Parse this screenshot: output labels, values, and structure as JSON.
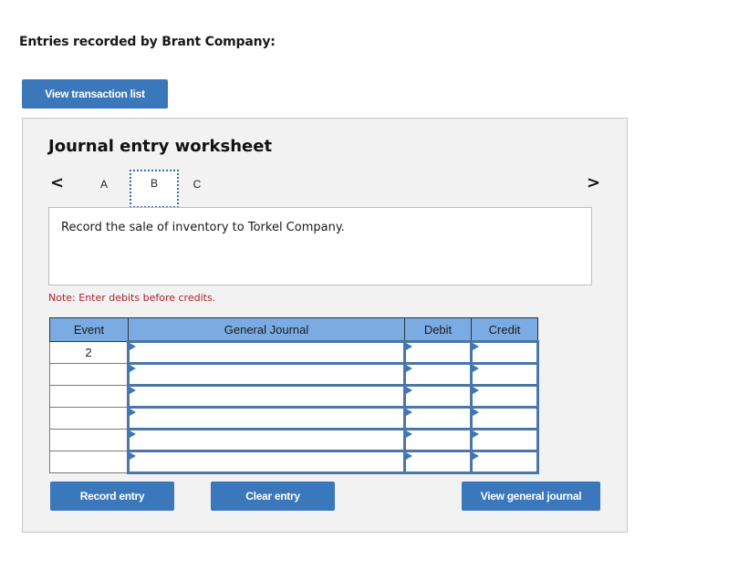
{
  "header": {
    "title": "Entries recorded by Brant Company:",
    "view_transaction_list_label": "View transaction list"
  },
  "worksheet": {
    "title": "Journal entry worksheet",
    "nav": {
      "prev_icon": "chevron-left-icon",
      "next_icon": "chevron-right-icon",
      "prev_glyph": "<",
      "next_glyph": ">"
    },
    "tabs": [
      {
        "label": "A",
        "active": false
      },
      {
        "label": "B",
        "active": true
      },
      {
        "label": "C",
        "active": false
      }
    ],
    "description": "Record the sale of inventory to Torkel Company.",
    "note": "Note: Enter debits before credits.",
    "table": {
      "columns": [
        "Event",
        "General Journal",
        "Debit",
        "Credit"
      ],
      "rows": [
        {
          "event": "2",
          "account": "",
          "debit": "",
          "credit": ""
        },
        {
          "event": "",
          "account": "",
          "debit": "",
          "credit": ""
        },
        {
          "event": "",
          "account": "",
          "debit": "",
          "credit": ""
        },
        {
          "event": "",
          "account": "",
          "debit": "",
          "credit": ""
        },
        {
          "event": "",
          "account": "",
          "debit": "",
          "credit": ""
        },
        {
          "event": "",
          "account": "",
          "debit": "",
          "credit": ""
        }
      ]
    },
    "buttons": {
      "record": "Record entry",
      "clear": "Clear entry",
      "view_general_journal": "View general journal"
    }
  },
  "colors": {
    "button_blue": "#3a77bb",
    "header_blue": "#7aace3",
    "note_red": "#b01f2c",
    "panel_bg": "#f2f2f2"
  }
}
